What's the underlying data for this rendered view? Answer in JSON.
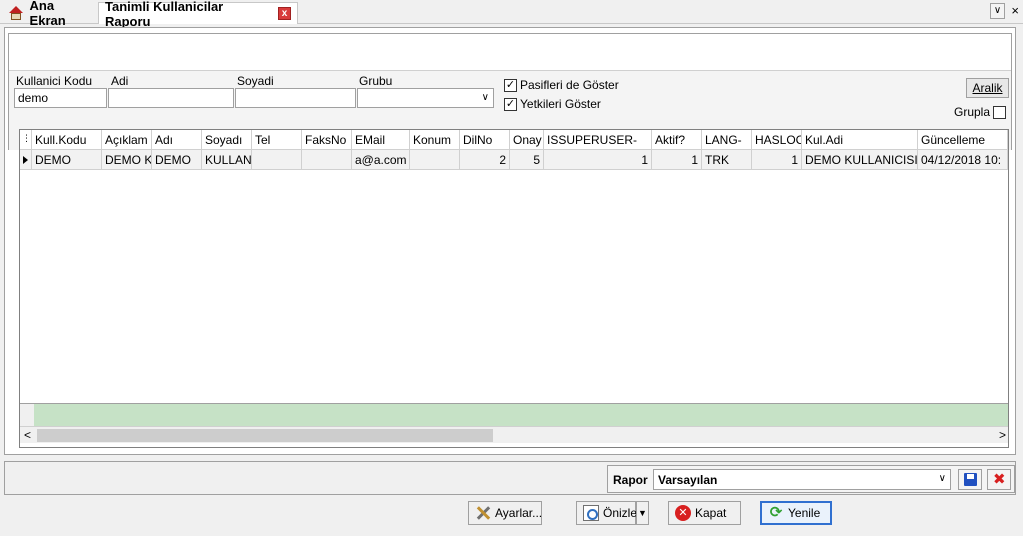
{
  "tabs": {
    "home": "Ana Ekran",
    "active": "Tanimli Kullanicilar Raporu",
    "close_glyph": "x",
    "menu_glyph": "∨",
    "window_close_glyph": "×"
  },
  "filters": {
    "labels": {
      "kod": "Kullanici Kodu",
      "adi": "Adi",
      "soyadi": "Soyadi",
      "grubu": "Grubu"
    },
    "values": {
      "kod": "demo",
      "adi": "",
      "soyadi": ""
    },
    "checks": {
      "pasif": "Pasifleri de Göster",
      "yetki": "Yetkileri Göster",
      "pasif_checked": true,
      "yetki_checked": true
    },
    "aralik_button": "Aralik",
    "grupla_label": "Grupla",
    "grupla_checked": false
  },
  "grid": {
    "columns": [
      "Kull.Kodu",
      "Açıklam",
      "Adı",
      "Soyadı",
      "Tel",
      "FaksNo",
      "EMail",
      "Konum",
      "DilNo",
      "Onay",
      "ISSUPERUSER-",
      "Aktif?",
      "LANG-",
      "HASLOC",
      "Kul.Adi",
      "Güncelleme"
    ],
    "rows": [
      [
        "DEMO",
        "DEMO K",
        "DEMO",
        "KULLAN",
        "",
        "",
        "a@a.com",
        "",
        "2",
        "5",
        "1",
        "1",
        "TRK",
        "1",
        "DEMO KULLANICISI",
        "04/12/2018 10:"
      ]
    ]
  },
  "rapor": {
    "label": "Rapor",
    "selected": "Varsayılan"
  },
  "buttons": {
    "ayarlar": "Ayarlar...",
    "onizle": "Önizle",
    "kapat": "Kapat",
    "yenile": "Yenile"
  },
  "colors": {
    "footer_green": "#c6e2c6",
    "focus_blue": "#3070d0",
    "delete_red": "#d82020"
  }
}
